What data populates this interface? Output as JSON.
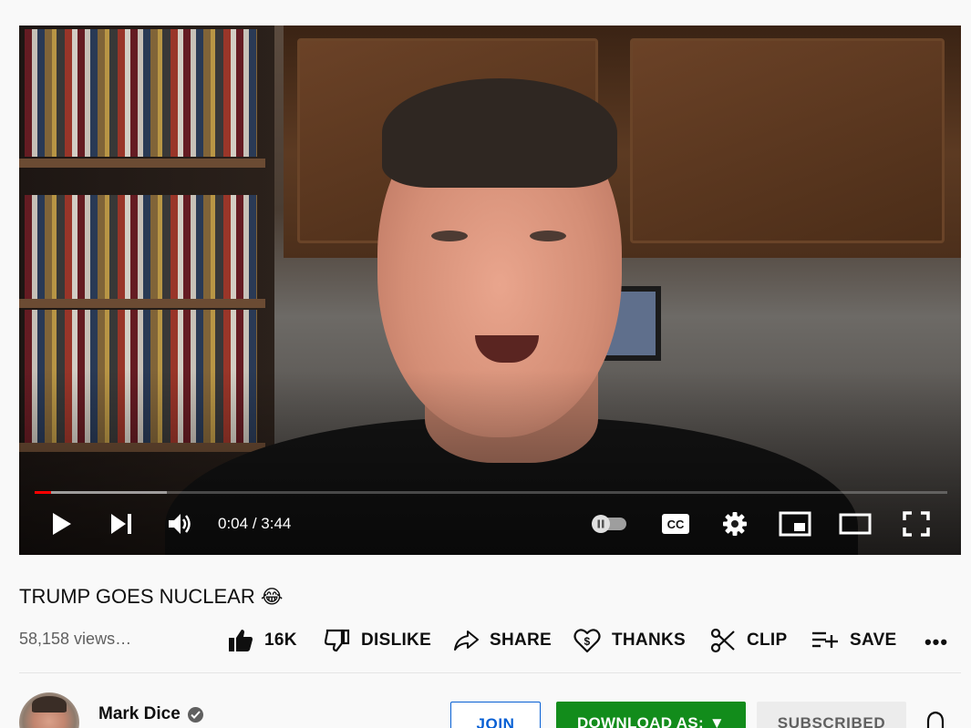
{
  "player": {
    "progress": {
      "played_fraction": 0.0179,
      "loaded_fraction": 0.145
    },
    "time": {
      "current": "0:04",
      "duration": "3:44",
      "display": "0:04 / 3:44"
    },
    "controls": {
      "play_icon": "play-icon",
      "next_icon": "next-icon",
      "volume_icon": "volume-icon",
      "autoplay_icon": "autoplay-toggle-icon",
      "captions_icon": "cc-icon",
      "settings_icon": "gear-icon",
      "miniplayer_icon": "miniplayer-icon",
      "theater_icon": "theater-icon",
      "fullscreen_icon": "fullscreen-icon"
    },
    "progress_color": "#ff0000"
  },
  "video": {
    "title": "TRUMP GOES NUCLEAR",
    "title_emoji": "😂",
    "views": "58,158 views…"
  },
  "actions": {
    "like": {
      "label": "16K",
      "icon": "thumbs-up-icon"
    },
    "dislike": {
      "label": "DISLIKE",
      "icon": "thumbs-down-icon"
    },
    "share": {
      "label": "SHARE",
      "icon": "share-icon"
    },
    "thanks": {
      "label": "THANKS",
      "icon": "thanks-heart-dollar-icon"
    },
    "clip": {
      "label": "CLIP",
      "icon": "scissors-icon"
    },
    "save": {
      "label": "SAVE",
      "icon": "playlist-add-icon"
    },
    "more": {
      "label": "•••",
      "icon": "more-icon"
    }
  },
  "channel": {
    "name": "Mark Dice",
    "verified_icon": "verified-check-icon",
    "join_label": "JOIN",
    "download_label": "DOWNLOAD AS:",
    "download_caret": "▼",
    "subscribed_label": "SUBSCRIBED",
    "bell_icon": "bell-icon"
  },
  "colors": {
    "download_green": "#128c1b",
    "join_blue": "#065fd4",
    "text_primary": "#0f0f0f",
    "text_secondary": "#606060"
  }
}
